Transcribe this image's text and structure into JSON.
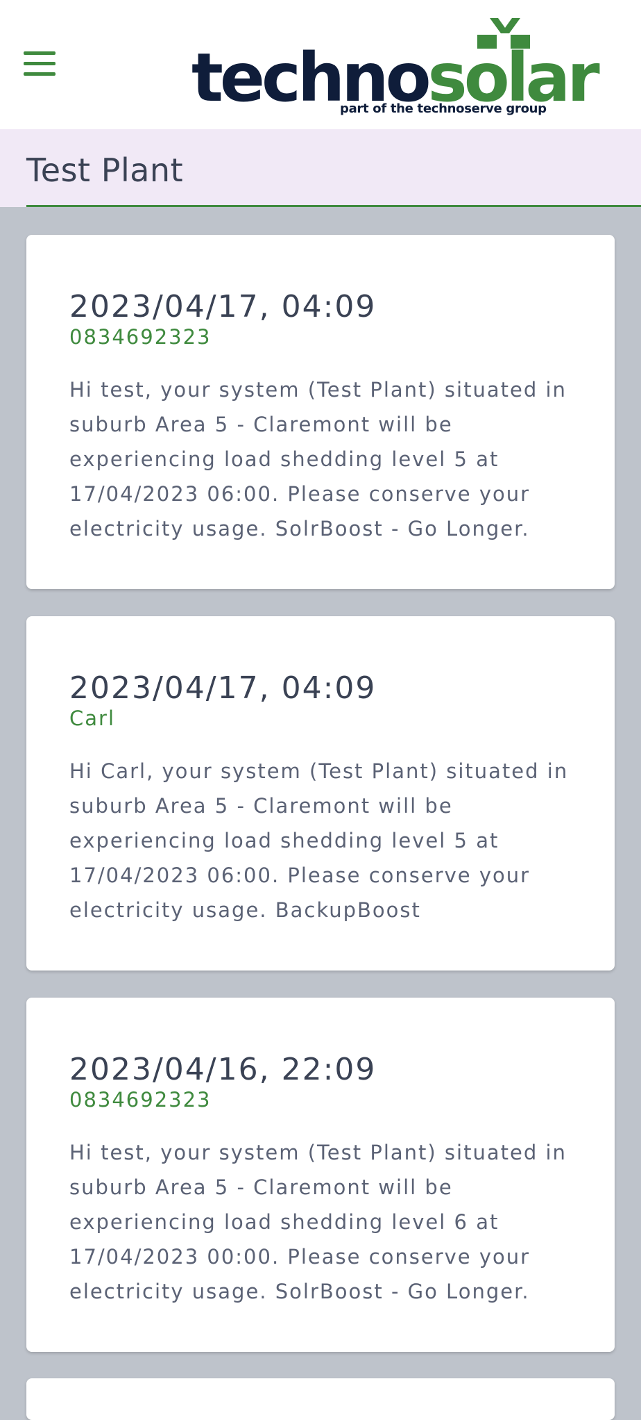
{
  "header": {
    "menu_icon": "hamburger-menu-icon",
    "logo_part1": "techno",
    "logo_part2": "solar",
    "logo_tagline": "part of the technoserve group",
    "brand_dark": "#0f1d3a",
    "brand_green": "#3f8a3e"
  },
  "page": {
    "title": "Test Plant"
  },
  "notifications": [
    {
      "date": "2023/04/17, 04:09",
      "sender": "0834692323",
      "message": "Hi test, your system (Test Plant) situated in suburb Area 5 - Claremont will be experiencing load shedding level 5 at 17/04/2023 06:00. Please conserve your electricity usage. SolrBoost - Go Longer."
    },
    {
      "date": "2023/04/17, 04:09",
      "sender": "Carl",
      "message": "Hi Carl, your system (Test Plant) situated in suburb Area 5 - Claremont will be experiencing load shedding level 5 at 17/04/2023 06:00. Please conserve your electricity usage. BackupBoost"
    },
    {
      "date": "2023/04/16, 22:09",
      "sender": "0834692323",
      "message": "Hi test, your system (Test Plant) situated in suburb Area 5 - Claremont will be experiencing load shedding level 6 at 17/04/2023 00:00. Please conserve your electricity usage. SolrBoost - Go Longer."
    }
  ]
}
